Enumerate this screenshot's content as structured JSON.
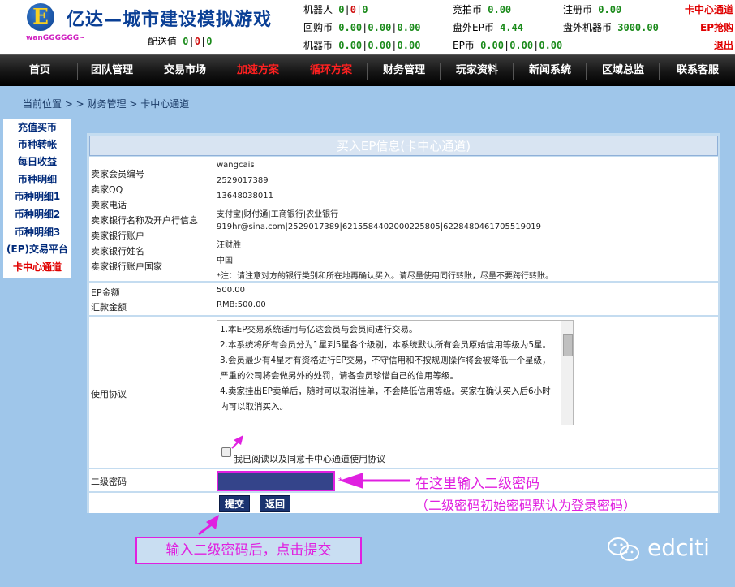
{
  "header": {
    "logo_letter": "E",
    "site_title": "亿达—城市建设模拟游戏",
    "username": "wanGGGGGG~",
    "stats": {
      "robot_label": "机器人",
      "robot_values": [
        "0",
        "0",
        "0"
      ],
      "deliver_label": "配送值",
      "deliver_values": [
        "0",
        "0",
        "0"
      ],
      "buyback_label": "回购币",
      "buyback_values": [
        "0.00",
        "0.00",
        "0.00"
      ],
      "machine_label": "机器币",
      "machine_values": [
        "0.00",
        "0.00",
        "0.00"
      ],
      "auction_label": "竞拍币",
      "auction_value": "0.00",
      "outer_ep_label": "盘外EP币",
      "outer_ep_value": "4.44",
      "ep_label": "EP币",
      "ep_values": [
        "0.00",
        "0.00",
        "0.00"
      ],
      "register_label": "注册币",
      "register_value": "0.00",
      "outer_machine_label": "盘外机器币",
      "outer_machine_value": "3000.00"
    },
    "links": [
      "卡中心通道",
      "EP抢购",
      "退出"
    ]
  },
  "nav": {
    "items": [
      {
        "label": "首页",
        "red": false
      },
      {
        "label": "团队管理",
        "red": false
      },
      {
        "label": "交易市场",
        "red": false
      },
      {
        "label": "加速方案",
        "red": true
      },
      {
        "label": "循环方案",
        "red": true
      },
      {
        "label": "财务管理",
        "red": false
      },
      {
        "label": "玩家资料",
        "red": false
      },
      {
        "label": "新闻系统",
        "red": false
      },
      {
        "label": "区域总监",
        "red": false
      },
      {
        "label": "联系客服",
        "red": false
      }
    ]
  },
  "breadcrumb": "当前位置 > > 财务管理 > 卡中心通道",
  "sidebar": {
    "items": [
      "充值买币",
      "币种转帐",
      "每日收益",
      "币种明细",
      "币种明细1",
      "币种明细2",
      "币种明细3",
      "(EP)交易平台",
      "卡中心通道"
    ],
    "active_index": 8
  },
  "form": {
    "title": "买入EP信息(卡中心通道)",
    "seller_labels": [
      "卖家会员编号",
      "卖家QQ",
      "卖家电话",
      "卖家银行名称及开户行信息",
      "卖家银行账户",
      "卖家银行姓名",
      "卖家银行账户国家"
    ],
    "seller_values": [
      "wangcais",
      "2529017389",
      "13648038011",
      "支付宝|财付通|工商银行|农业银行",
      "919hr@sina.com|2529017389|6215584402000225805|6228480461705519019",
      "汪财胜",
      "中国",
      "*注：请注意对方的银行类别和所在地再确认买入。请尽量使用同行转账，尽量不要跨行转账。"
    ],
    "amount_labels": [
      "EP金额",
      "汇款金额"
    ],
    "amount_values": [
      "500.00",
      "RMB:500.00"
    ],
    "agreement_label": "使用协议",
    "agreement_lines": [
      "1.本EP交易系统适用与亿达会员与会员间进行交易。",
      "2.本系统将所有会员分为1星到5星各个级别，本系统默认所有会员原始信用等级为5星。",
      "3.会员最少有4星才有资格进行EP交易，不守信用和不按规则操作将会被降低一个星级，严重的公司将会做另外的处罚，请各会员珍惜自己的信用等级。",
      "4.卖家挂出EP卖单后，随时可以取消挂单，不会降低信用等级。买家在确认买入后6小时内可以取消买入。"
    ],
    "agree_text": "我已阅读以及同意卡中心通道使用协议",
    "password_label": "二级密码",
    "required_mark": "*",
    "submit_label": "提交",
    "back_label": "返回"
  },
  "annotations": {
    "enter_password": "在这里输入二级密码",
    "password_note": "（二级密码初始密码默认为登录密码）",
    "after_enter": "输入二级密码后，点击提交"
  },
  "watermark": "edciti"
}
